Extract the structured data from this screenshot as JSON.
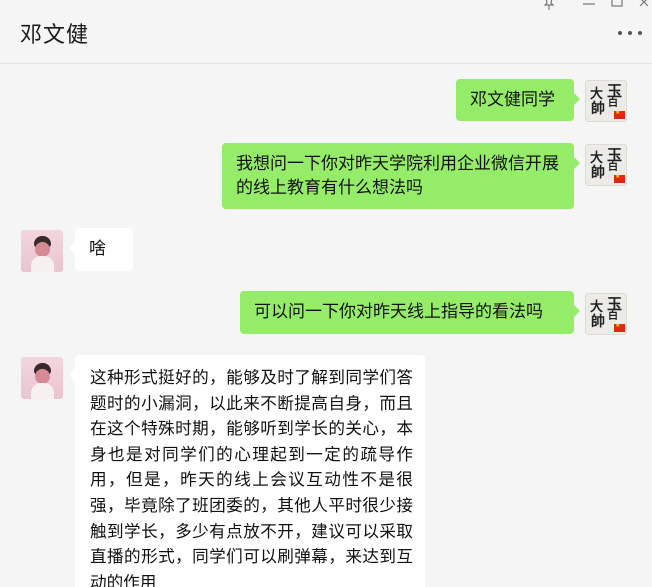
{
  "header": {
    "title": "邓文健",
    "pin_icon": "pin-icon",
    "minimize_icon": "minimize-icon",
    "maximize_icon": "maximize-icon",
    "close_icon": "close-icon",
    "more_icon": "more-dots-icon"
  },
  "avatar_me": {
    "chars": [
      "玉",
      "大",
      "帥",
      "白"
    ]
  },
  "messages": [
    {
      "sender": "me",
      "text": "邓文健同学"
    },
    {
      "sender": "me",
      "text": "我想问一下你对昨天学院利用企业微信开展的线上教育有什么想法吗"
    },
    {
      "sender": "other",
      "text": "啥"
    },
    {
      "sender": "me",
      "text": "可以问一下你对昨天线上指导的看法吗"
    },
    {
      "sender": "other",
      "text": "这种形式挺好的，能够及时了解到同学们答题时的小漏洞，以此来不断提高自身，而且在这个特殊时期，能够听到学长的关心，本身也是对同学们的心理起到一定的疏导作用，但是，昨天的线上会议互动性不是很强，毕竟除了班团委的，其他人平时很少接触到学长，多少有点放不开，建议可以采取直播的形式，同学们可以刷弹幕，来达到互动的作用"
    }
  ],
  "colors": {
    "me_bubble": "#95ec69",
    "other_bubble": "#ffffff",
    "background": "#f5f5f5"
  }
}
